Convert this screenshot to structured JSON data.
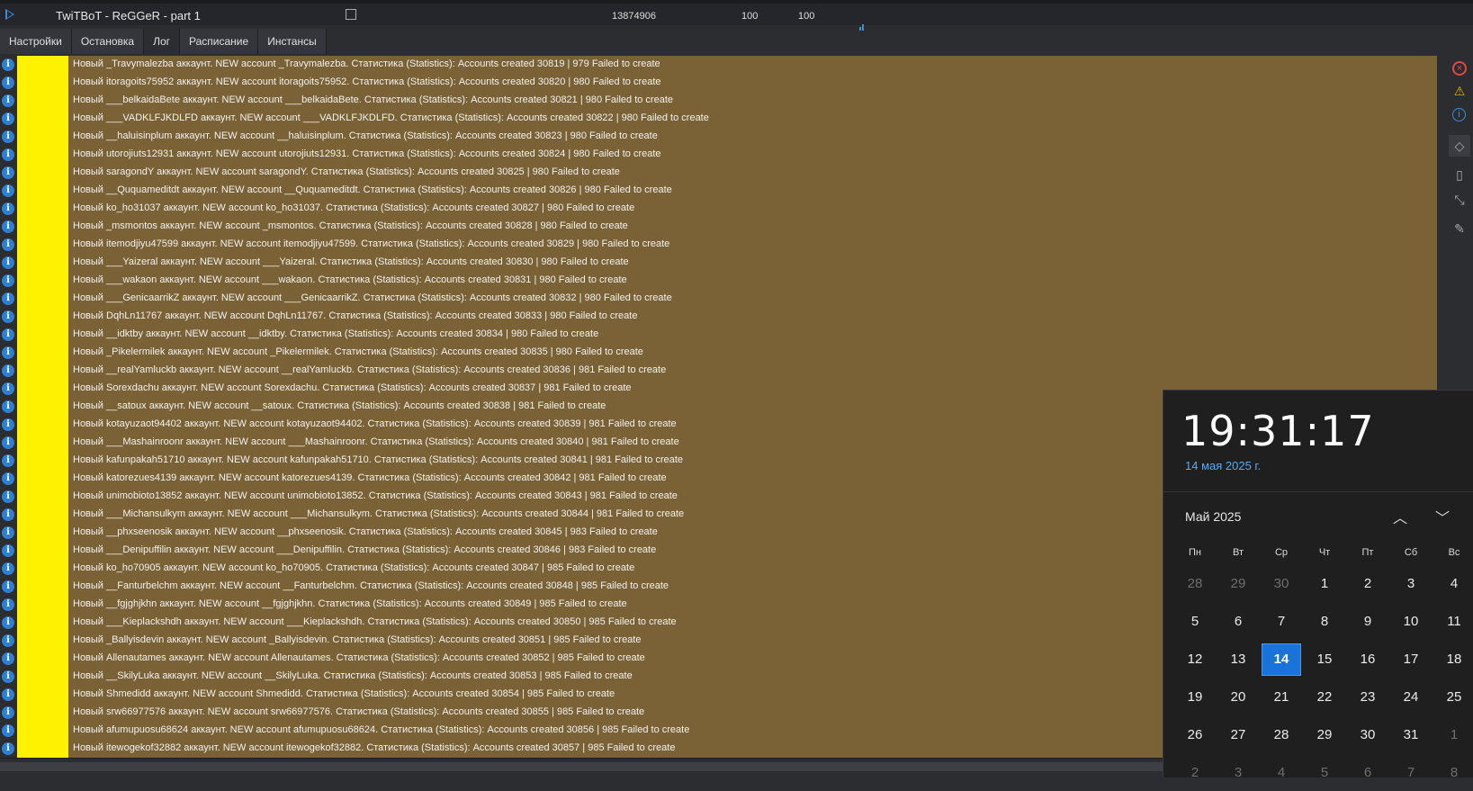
{
  "topbar": {
    "title": "TwiTBoT - ReGGeR - part 1",
    "value1": "13874906",
    "value2": "100",
    "value3": "100"
  },
  "tabs": [
    {
      "label": "Настройки"
    },
    {
      "label": "Остановка"
    },
    {
      "label": "Лог"
    },
    {
      "label": "Расписание"
    },
    {
      "label": "Инстансы"
    }
  ],
  "log_rows": [
    "Новый _Travymalezba аккаунт. NEW account _Travymalezba. Статистика (Statistics): Accounts created 30819 |  979 Failed to create",
    "Новый itoragoits75952 аккаунт. NEW account itoragoits75952. Статистика (Statistics): Accounts created 30820 |  980 Failed to create",
    "Новый ___belkaidaBete аккаунт. NEW account ___belkaidaBete. Статистика (Statistics): Accounts created 30821 |  980 Failed to create",
    "Новый ___VADKLFJKDLFD аккаунт. NEW account ___VADKLFJKDLFD. Статистика (Statistics): Accounts created 30822 |  980 Failed to create",
    "Новый __haluisinplum аккаунт. NEW account __haluisinplum. Статистика (Statistics): Accounts created 30823 |  980 Failed to create",
    "Новый utorojiuts12931 аккаунт. NEW account utorojiuts12931. Статистика (Statistics): Accounts created 30824 |  980 Failed to create",
    "Новый saragondY аккаунт. NEW account saragondY. Статистика (Statistics): Accounts created 30825 |  980 Failed to create",
    "Новый __Ququameditdt аккаунт. NEW account __Ququameditdt. Статистика (Statistics): Accounts created 30826 |  980 Failed to create",
    "Новый ko_ho31037 аккаунт. NEW account ko_ho31037. Статистика (Statistics): Accounts created 30827 |  980 Failed to create",
    "Новый _msmontos аккаунт. NEW account _msmontos. Статистика (Statistics): Accounts created 30828 |  980 Failed to create",
    "Новый itemodjiyu47599 аккаунт. NEW account itemodjiyu47599. Статистика (Statistics): Accounts created 30829 |  980 Failed to create",
    "Новый ___Yaizeral аккаунт. NEW account ___Yaizeral. Статистика (Statistics): Accounts created 30830 |  980 Failed to create",
    "Новый ___wakaon аккаунт. NEW account ___wakaon. Статистика (Statistics): Accounts created 30831 |  980 Failed to create",
    "Новый ___GenicaarrikZ аккаунт. NEW account ___GenicaarrikZ. Статистика (Statistics): Accounts created 30832 |  980 Failed to create",
    "Новый DqhLn11767 аккаунт. NEW account DqhLn11767. Статистика (Statistics): Accounts created 30833 |  980 Failed to create",
    "Новый __idktby аккаунт. NEW account __idktby. Статистика (Statistics): Accounts created 30834 |  980 Failed to create",
    "Новый _Pikelermilek аккаунт. NEW account _Pikelermilek. Статистика (Statistics): Accounts created 30835 |  980 Failed to create",
    "Новый __realYamluckb аккаунт. NEW account __realYamluckb. Статистика (Statistics): Accounts created 30836 |  981 Failed to create",
    "Новый Sorexdachu аккаунт. NEW account Sorexdachu. Статистика (Statistics): Accounts created 30837 |  981 Failed to create",
    "Новый __satoux аккаунт. NEW account __satoux. Статистика (Statistics): Accounts created 30838 |  981 Failed to create",
    "Новый kotayuzaot94402 аккаунт. NEW account kotayuzaot94402. Статистика (Statistics): Accounts created 30839 |  981 Failed to create",
    "Новый ___Mashainroonr аккаунт. NEW account ___Mashainroonr. Статистика (Statistics): Accounts created 30840 |  981 Failed to create",
    "Новый kafunpakah51710 аккаунт. NEW account kafunpakah51710. Статистика (Statistics): Accounts created 30841 |  981 Failed to create",
    "Новый katorezues4139 аккаунт. NEW account katorezues4139. Статистика (Statistics): Accounts created 30842 |  981 Failed to create",
    "Новый unimobioto13852 аккаунт. NEW account unimobioto13852. Статистика (Statistics): Accounts created 30843 |  981 Failed to create",
    "Новый ___Michansulkym аккаунт. NEW account ___Michansulkym. Статистика (Statistics): Accounts created 30844 |  981 Failed to create",
    "Новый __phxseenosik аккаунт. NEW account __phxseenosik. Статистика (Statistics): Accounts created 30845 |  983 Failed to create",
    "Новый ___Denipuffilin аккаунт. NEW account ___Denipuffilin. Статистика (Statistics): Accounts created 30846 |  983 Failed to create",
    "Новый ko_ho70905 аккаунт. NEW account ko_ho70905. Статистика (Statistics): Accounts created 30847 |  985 Failed to create",
    "Новый __Fanturbelchm аккаунт. NEW account __Fanturbelchm. Статистика (Statistics): Accounts created 30848 |  985 Failed to create",
    "Новый __fgjghjkhn аккаунт. NEW account __fgjghjkhn. Статистика (Statistics): Accounts created 30849 |  985 Failed to create",
    "Новый ___Kieplackshdh аккаунт. NEW account ___Kieplackshdh. Статистика (Statistics): Accounts created 30850 |  985 Failed to create",
    "Новый _Ballyisdevin аккаунт. NEW account _Ballyisdevin. Статистика (Statistics): Accounts created 30851 |  985 Failed to create",
    "Новый Allenautames аккаунт. NEW account Allenautames. Статистика (Statistics): Accounts created 30852 |  985 Failed to create",
    "Новый __SkilyLuka аккаунт. NEW account __SkilyLuka. Статистика (Statistics): Accounts created 30853 |  985 Failed to create",
    "Новый Shmedidd аккаунт. NEW account Shmedidd. Статистика (Statistics): Accounts created 30854 |  985 Failed to create",
    "Новый srw66977576 аккаунт. NEW account srw66977576. Статистика (Statistics): Accounts created 30855 |  985 Failed to create",
    "Новый afumupuosu68624 аккаунт. NEW account afumupuosu68624. Статистика (Statistics): Accounts created 30856 |  985 Failed to create",
    "Новый itewogekof32882 аккаунт. NEW account itewogekof32882. Статистика (Statistics): Accounts created 30857 |  985 Failed to create"
  ],
  "info_icon_glyph": "i",
  "side_icons": [
    "error-filter-icon",
    "warning-filter-icon",
    "info-filter-icon",
    "tag-icon",
    "phone-icon",
    "expand-icon",
    "pin-icon"
  ],
  "clock": {
    "time": "19:31:17",
    "date": "14 мая 2025 г.",
    "month_label": "Май 2025",
    "weekdays": [
      "Пн",
      "Вт",
      "Ср",
      "Чт",
      "Пт",
      "Сб",
      "Вс"
    ],
    "weeks": [
      [
        {
          "d": "28",
          "dim": true
        },
        {
          "d": "29",
          "dim": true
        },
        {
          "d": "30",
          "dim": true
        },
        {
          "d": "1"
        },
        {
          "d": "2"
        },
        {
          "d": "3"
        },
        {
          "d": "4"
        }
      ],
      [
        {
          "d": "5"
        },
        {
          "d": "6"
        },
        {
          "d": "7"
        },
        {
          "d": "8"
        },
        {
          "d": "9"
        },
        {
          "d": "10"
        },
        {
          "d": "11"
        }
      ],
      [
        {
          "d": "12"
        },
        {
          "d": "13"
        },
        {
          "d": "14",
          "today": true
        },
        {
          "d": "15"
        },
        {
          "d": "16"
        },
        {
          "d": "17"
        },
        {
          "d": "18"
        }
      ],
      [
        {
          "d": "19"
        },
        {
          "d": "20"
        },
        {
          "d": "21"
        },
        {
          "d": "22"
        },
        {
          "d": "23"
        },
        {
          "d": "24"
        },
        {
          "d": "25"
        }
      ],
      [
        {
          "d": "26"
        },
        {
          "d": "27"
        },
        {
          "d": "28"
        },
        {
          "d": "29"
        },
        {
          "d": "30"
        },
        {
          "d": "31"
        },
        {
          "d": "1",
          "dim": true
        }
      ],
      [
        {
          "d": "2",
          "dim": true
        },
        {
          "d": "3",
          "dim": true
        },
        {
          "d": "4",
          "dim": true
        },
        {
          "d": "5",
          "dim": true
        },
        {
          "d": "6",
          "dim": true
        },
        {
          "d": "7",
          "dim": true
        },
        {
          "d": "8",
          "dim": true
        }
      ]
    ]
  },
  "colors": {
    "log_background": "#7a6136",
    "marker_column": "#fff200",
    "info_icon": "#2f7fd0",
    "today_highlight": "#1a73d9",
    "date_text": "#5fa8ef"
  }
}
